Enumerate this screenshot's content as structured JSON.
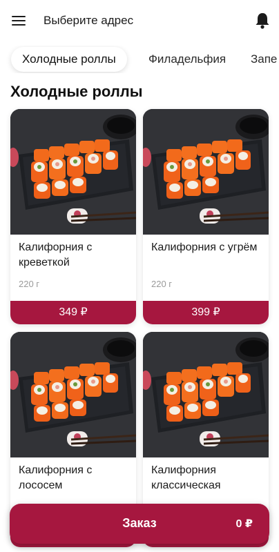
{
  "header": {
    "menu_icon": "hamburger-menu-icon",
    "address_label": "Выберите адрес",
    "bell_icon": "notification-bell-icon"
  },
  "tabs": [
    {
      "label": "Холодные роллы",
      "active": true
    },
    {
      "label": "Филадельфия",
      "active": false
    },
    {
      "label": "Запе",
      "active": false
    }
  ],
  "section": {
    "title": "Холодные роллы"
  },
  "products": [
    {
      "name": "Калифорния с креветкой",
      "weight": "220 г",
      "price": "349 ₽",
      "image": "sushi-rolls-photo"
    },
    {
      "name": "Калифорния с угрём",
      "weight": "220 г",
      "price": "399 ₽",
      "image": "sushi-rolls-photo"
    },
    {
      "name": "Калифорния с лососем",
      "weight": "",
      "price": "",
      "image": "sushi-rolls-photo"
    },
    {
      "name": "Калифорния классическая",
      "weight": "",
      "price": "",
      "image": "sushi-rolls-photo"
    }
  ],
  "order": {
    "label": "Заказ",
    "total": "0 ₽"
  },
  "colors": {
    "accent": "#a6173f",
    "text": "#1b1b1b",
    "muted": "#9a9a9a",
    "photo_bg": "#2c2d30"
  }
}
